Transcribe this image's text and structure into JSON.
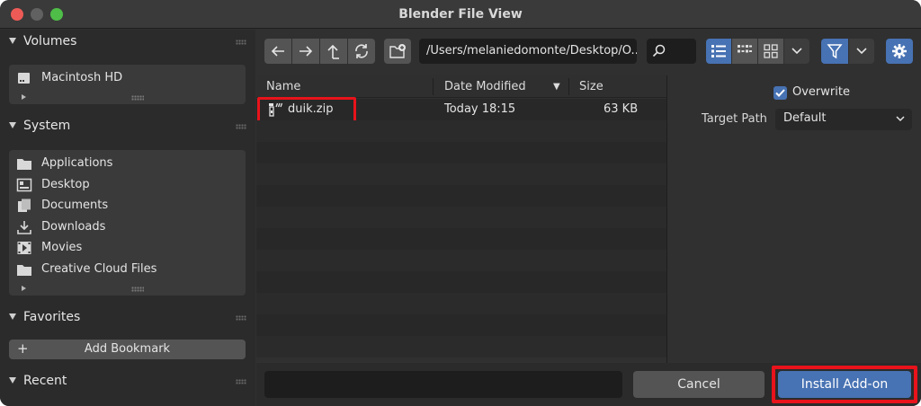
{
  "window": {
    "title": "Blender File View"
  },
  "sidebar": {
    "volumes": {
      "label": "Volumes",
      "items": [
        {
          "label": "Macintosh HD",
          "icon": "disk-icon"
        }
      ]
    },
    "system": {
      "label": "System",
      "items": [
        {
          "label": "Applications",
          "icon": "folder-icon"
        },
        {
          "label": "Desktop",
          "icon": "desktop-icon"
        },
        {
          "label": "Documents",
          "icon": "documents-icon"
        },
        {
          "label": "Downloads",
          "icon": "download-icon"
        },
        {
          "label": "Movies",
          "icon": "film-icon"
        },
        {
          "label": "Creative Cloud Files",
          "icon": "folder-icon"
        }
      ]
    },
    "favorites": {
      "label": "Favorites",
      "add_bookmark_label": "Add Bookmark",
      "add_symbol": "+"
    },
    "recent": {
      "label": "Recent"
    }
  },
  "toolbar": {
    "path": "/Users/melaniedomonte/Desktop/O..."
  },
  "file_list": {
    "columns": {
      "name": "Name",
      "date": "Date Modified",
      "size": "Size"
    },
    "sort_indicator": "▼",
    "files": [
      {
        "name": "duik.zip",
        "date": "Today 18:15",
        "size": "63 KB",
        "icon": "zip-file-icon"
      }
    ]
  },
  "options": {
    "overwrite_label": "Overwrite",
    "overwrite_checked": true,
    "target_path_label": "Target Path",
    "target_path_value": "Default"
  },
  "footer": {
    "filename_value": "",
    "cancel_label": "Cancel",
    "install_label": "Install Add-on"
  },
  "colors": {
    "accent_blue": "#4772b3",
    "highlight_red": "#e8131b",
    "background": "#303030"
  }
}
